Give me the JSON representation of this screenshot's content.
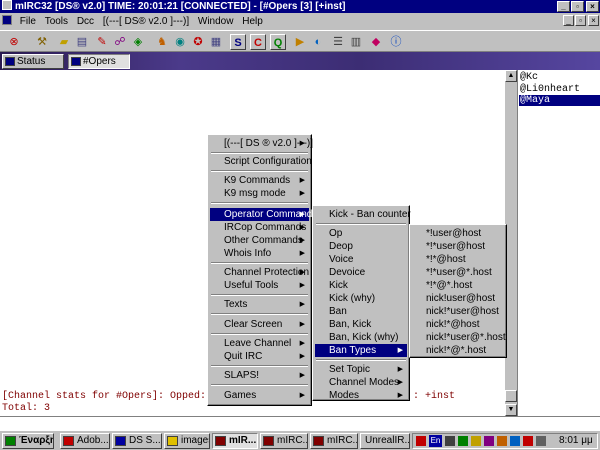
{
  "window": {
    "title": "mIRC32 [DS® v2.0] TIME: 20:01:21 [CONNECTED] - [#Opers [3] [+inst]",
    "buttons": {
      "minimize": "_",
      "restore": "▫",
      "close": "×"
    }
  },
  "menubar": [
    "File",
    "Tools",
    "Dcc",
    "[(---[ DS® v2.0 ]---)]",
    "Window",
    "Help"
  ],
  "switchbar": {
    "tabs": [
      "Status",
      "#Opers"
    ]
  },
  "chat": {
    "lines": [
      "[Channel stats for #Opers]: Opped: ",
      "Total: 3"
    ],
    "modes_tail": ": +inst"
  },
  "nicklist": [
    "@Kc",
    "@Li0nheart",
    "@Maya"
  ],
  "menu1": {
    "items": [
      "[(---[ DS ® v2.0 ]---)]",
      "Script Configuration",
      "K9 Commands",
      "K9 msg mode",
      "Operator Commands",
      "IRCop Commands",
      "Other Commands",
      "Whois Info",
      "Channel Protection",
      "Useful Tools",
      "Texts",
      "Clear Screen",
      "Leave Channel",
      "Quit IRC",
      "SLAPS!",
      "Games"
    ]
  },
  "menu2": {
    "items": [
      "Kick - Ban counter",
      "Op",
      "Deop",
      "Voice",
      "Devoice",
      "Kick",
      "Kick (why)",
      "Ban",
      "Ban, Kick",
      "Ban, Kick (why)",
      "Ban Types",
      "Set Topic",
      "Channel Modes",
      "Modes"
    ]
  },
  "menu3": {
    "items": [
      "*!user@host",
      "*!*user@host",
      "*!*@host",
      "*!*user@*.host",
      "*!*@*.host",
      "nick!user@host",
      "nick!*user@host",
      "nick!*@host",
      "nick!*user@*.host",
      "nick!*@*.host"
    ]
  },
  "taskbar": {
    "start": "Έναρξη",
    "tasks": [
      "Adob...",
      "DS S...",
      "images",
      "mIR...",
      "mIRC...",
      "mIRC...",
      "UnrealIR..."
    ],
    "tray_lang": "En",
    "clock": "8:01 μμ"
  },
  "colors": {
    "titlebar": "#000080",
    "face": "#c0c0c0",
    "highlight": "#000080",
    "chat_text": "#7f0000"
  }
}
